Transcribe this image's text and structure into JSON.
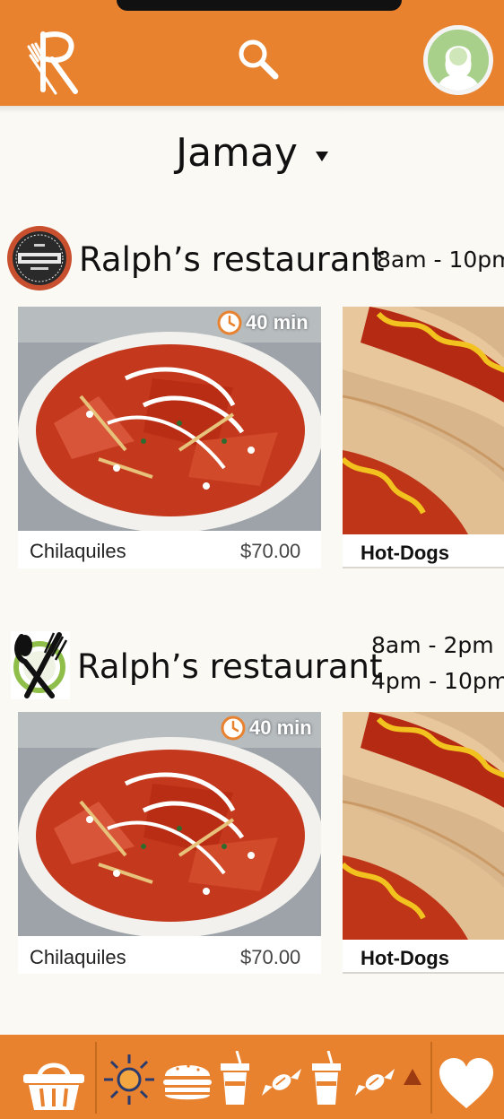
{
  "header": {
    "logo_icon": "fork-knife-r-logo-icon",
    "search_icon": "search-icon",
    "avatar_icon": "user-avatar-icon",
    "bar_color": "#e9822e"
  },
  "location": {
    "city": "Jamay",
    "dropdown_icon": "chevron-down-icon"
  },
  "restaurants": [
    {
      "name": "Ralph’s restaurant",
      "hours": [
        "8am - 10pm"
      ],
      "logo_icon": "restaurant-badge-icon",
      "dishes": [
        {
          "name": "Chilaquiles",
          "price": "$70.00",
          "prep_time": "40 min"
        },
        {
          "name": "Hot-Dogs"
        }
      ]
    },
    {
      "name": "Ralph’s restaurant",
      "hours": [
        "8am - 2pm",
        "4pm - 10pm"
      ],
      "logo_icon": "fork-knife-circle-icon",
      "dishes": [
        {
          "name": "Chilaquiles",
          "price": "$70.00",
          "prep_time": "40 min"
        },
        {
          "name": "Hot-Dogs"
        }
      ]
    }
  ],
  "bottom_nav": {
    "basket_icon": "basket-icon",
    "categories": [
      "sun-icon",
      "burger-icon",
      "drink-icon",
      "candy-icon",
      "drink-icon",
      "candy-icon"
    ],
    "expand_icon": "triangle-up-icon",
    "favorites_icon": "heart-icon"
  }
}
